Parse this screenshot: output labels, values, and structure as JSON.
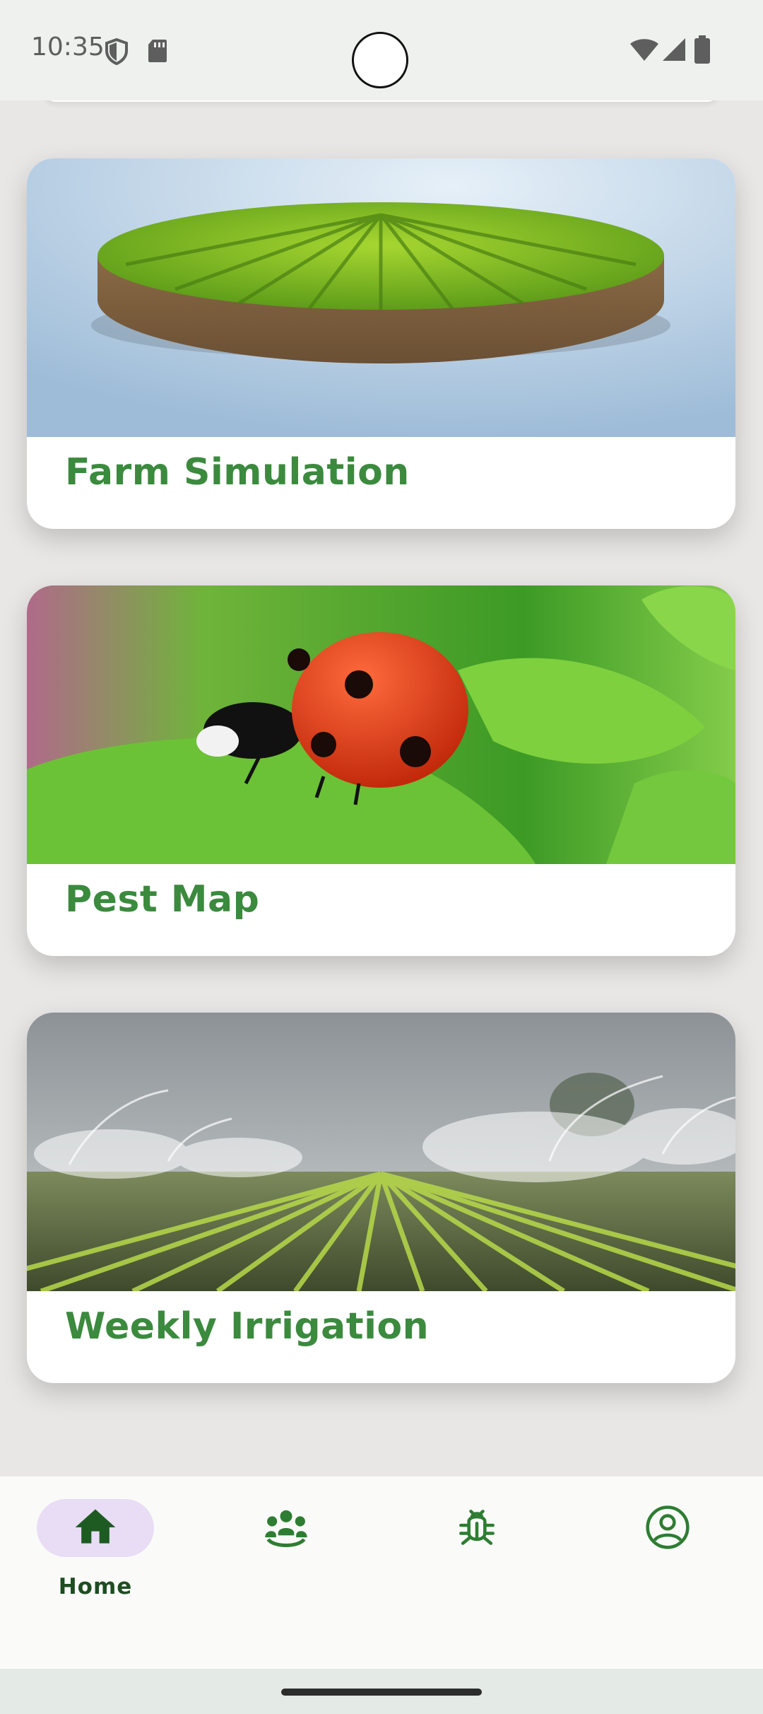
{
  "status_bar": {
    "time": "10:35",
    "icons": [
      "shield-icon",
      "sd-card-icon",
      "wifi-icon",
      "signal-icon",
      "battery-icon"
    ]
  },
  "cards": [
    {
      "title": "Farm Simulation",
      "image": "circular-crop-field-image"
    },
    {
      "title": "Pest Map",
      "image": "ladybug-on-leaf-image"
    },
    {
      "title": "Weekly Irrigation",
      "image": "sprinkler-irrigation-field-image"
    }
  ],
  "bottom_nav": {
    "items": [
      {
        "label": "Home",
        "icon": "home-icon",
        "active": true
      },
      {
        "label": "",
        "icon": "community-icon",
        "active": false
      },
      {
        "label": "",
        "icon": "bug-icon",
        "active": false
      },
      {
        "label": "",
        "icon": "profile-icon",
        "active": false
      }
    ]
  },
  "colors": {
    "title_green": "#3b8a3e",
    "nav_icon_green": "#2e7d32",
    "active_pill": "#e8ddf4"
  }
}
